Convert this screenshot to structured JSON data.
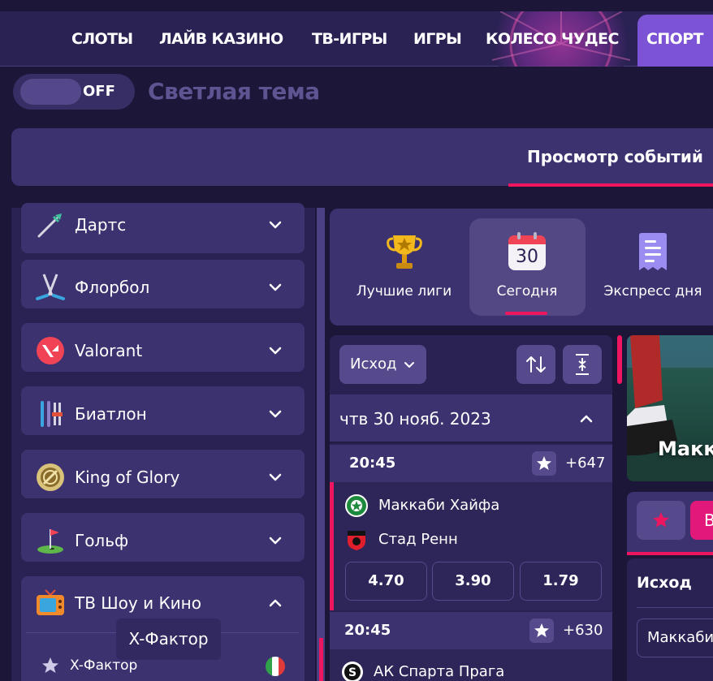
{
  "nav": {
    "items": [
      "Слоты",
      "Лайв казино",
      "ТВ-игры",
      "Игры",
      "Колесо чудес",
      "Спорт"
    ],
    "active_color": "#7d53d6"
  },
  "theme": {
    "toggle_state": "OFF",
    "label": "Светлая тема"
  },
  "events_tab": {
    "label": "Просмотр событий",
    "underline_color": "#f0155f"
  },
  "sidebar": {
    "sports": [
      {
        "label": "Дартс",
        "icon": "darts-icon"
      },
      {
        "label": "Флорбол",
        "icon": "floorball-icon"
      },
      {
        "label": "Valorant",
        "icon": "valorant-icon"
      },
      {
        "label": "Биатлон",
        "icon": "biathlon-icon"
      },
      {
        "label": "King of Glory",
        "icon": "king-of-glory-icon"
      },
      {
        "label": "Гольф",
        "icon": "golf-icon"
      }
    ],
    "expanded": {
      "label": "ТВ Шоу и Кино",
      "icon": "tv-icon"
    },
    "tooltip": "X-Фактор",
    "subitem": {
      "label": "X-Фактор",
      "flag": "italy-flag-icon"
    }
  },
  "categories": [
    {
      "label": "Лучшие лиги",
      "icon": "trophy-icon"
    },
    {
      "label": "Сегодня",
      "icon": "calendar-icon",
      "icon_text": "30",
      "active": true
    },
    {
      "label": "Экспресс дня",
      "icon": "receipt-icon"
    }
  ],
  "list": {
    "filter_label": "Исход",
    "date": "чтв 30 нояб. 2023",
    "matches": [
      {
        "time": "20:45",
        "more": "+647",
        "home": "Маккаби Хайфа",
        "away": "Стад Ренн",
        "odds": [
          "4.70",
          "3.90",
          "1.79"
        ]
      },
      {
        "time": "20:45",
        "more": "+630",
        "home": "АК Спарта Прага"
      }
    ]
  },
  "promo": {
    "title": "Макка",
    "button_partial": "В",
    "outcome_label": "Исход",
    "select_partial": "Маккаби"
  }
}
